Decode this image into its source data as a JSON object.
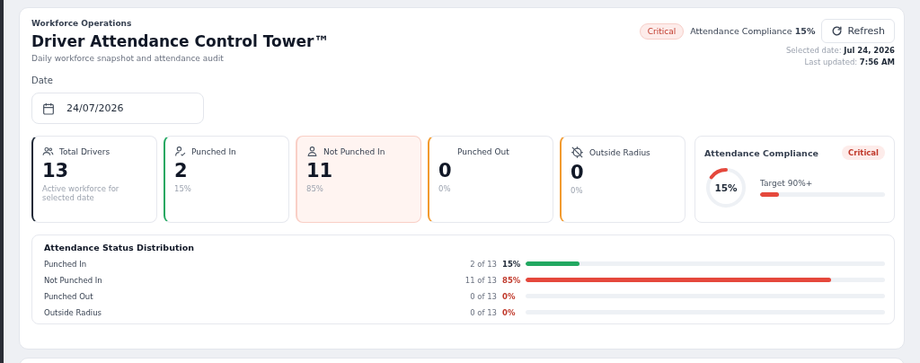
{
  "header": {
    "eyebrow": "Workforce Operations",
    "title": "Driver Attendance Control Tower™",
    "subtitle": "Daily workforce snapshot and attendance audit",
    "badge": "Critical",
    "compliance_label": "Attendance Compliance",
    "compliance_value": "15%",
    "refresh": "Refresh",
    "selected_date_label": "Selected date:",
    "selected_date": "Jul 24, 2026",
    "updated_label": "Last updated:",
    "updated": "7:56 AM"
  },
  "date_filter": {
    "label": "Date",
    "value": "24/07/2026"
  },
  "kpis": [
    {
      "kind": "total",
      "label": "Total Drivers",
      "value": "13",
      "note": "Active workforce for selected date"
    },
    {
      "kind": "in",
      "label": "Punched In",
      "value": "2",
      "note": "15%"
    },
    {
      "kind": "not_in",
      "label": "Not Punched In",
      "value": "11",
      "note": "85%"
    },
    {
      "kind": "out",
      "label": "Punched Out",
      "value": "0",
      "note": "0%"
    },
    {
      "kind": "outside",
      "label": "Outside Radius",
      "value": "0",
      "note": "0%"
    }
  ],
  "compliance_card": {
    "title": "Attendance Compliance",
    "badge": "Critical",
    "percent": "15%",
    "level": 0.15,
    "target": "Target 90%+"
  },
  "distribution": {
    "title": "Attendance Status Distribution",
    "rows": [
      {
        "kind": "positive",
        "label": "Punched In",
        "count": "2 of 13",
        "percent": "15%",
        "level": 0.15
      },
      {
        "kind": "negative",
        "label": "Not Punched In",
        "count": "11 of 13",
        "percent": "85%",
        "level": 0.85
      },
      {
        "kind": "negative",
        "label": "Punched Out",
        "count": "0 of 13",
        "percent": "0%"
      },
      {
        "kind": "negative",
        "label": "Outside Radius",
        "count": "0 of 13",
        "percent": "0%"
      }
    ]
  }
}
